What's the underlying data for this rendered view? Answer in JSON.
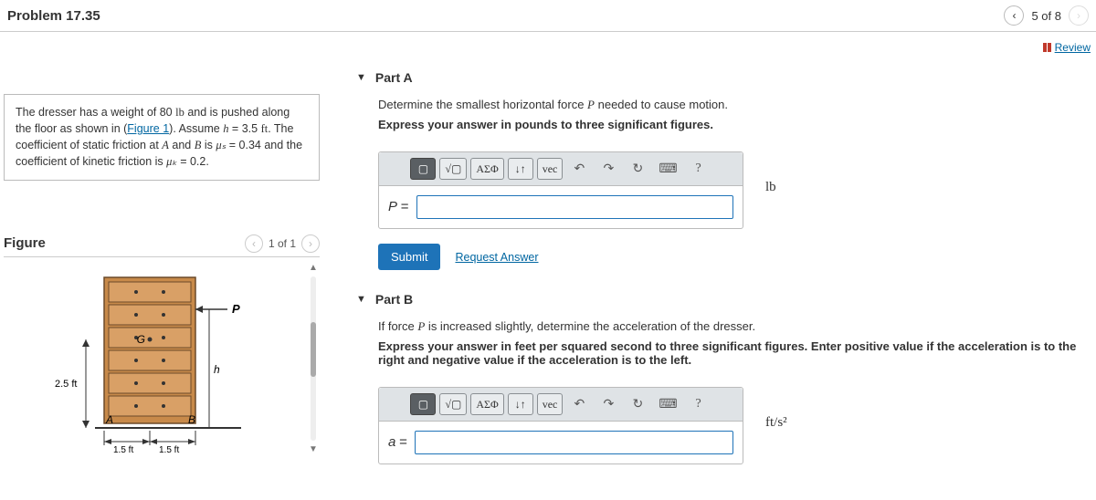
{
  "header": {
    "title": "Problem 17.35",
    "counter": "5 of 8"
  },
  "review_label": "Review",
  "problem": {
    "t1": "The dresser has a weight of 80 ",
    "lb": "lb",
    "t2": " and is pushed along the floor as shown in (",
    "fig_link": "Figure 1",
    "t3": "). Assume ",
    "h_var": "h",
    "t4": " = 3.5 ",
    "ft": "ft",
    "t5": ". The coefficient of static friction at ",
    "A": "A",
    "and": " and ",
    "B": "B",
    "t6": " is ",
    "mu_s": "μₛ",
    "t7": " = 0.34 and the coefficient of kinetic friction is ",
    "mu_k": "μₖ",
    "t8": " = 0.2."
  },
  "figure": {
    "title": "Figure",
    "counter": "1 of 1",
    "labels": {
      "P": "P",
      "G": "G",
      "h": "h",
      "A": "A",
      "B": "B",
      "h25": "2.5 ft",
      "w1": "1.5 ft",
      "w2": "1.5 ft"
    }
  },
  "toolbar": {
    "tpl": "▢",
    "sqrt": "√▢",
    "greek": "ΑΣΦ",
    "updown": "↓↑",
    "vec": "vec",
    "undo": "↶",
    "redo": "↷",
    "reset": "↻",
    "keyb": "⌨",
    "help": "?"
  },
  "partA": {
    "title": "Part A",
    "q": "Determine the smallest horizontal force ",
    "P": "P",
    "q2": " needed to cause motion.",
    "instr": "Express your answer in pounds to three significant figures.",
    "var": "P",
    "eq": "=",
    "unit": "lb",
    "submit": "Submit",
    "request": "Request Answer"
  },
  "partB": {
    "title": "Part B",
    "q": "If force ",
    "P": "P",
    "q2": " is increased slightly, determine the acceleration of the dresser.",
    "instr": "Express your answer in feet per squared second to three significant figures. Enter positive value if the acceleration is to the right and negative value if the acceleration is to the left.",
    "var": "a",
    "eq": "=",
    "unit": "ft/s²"
  }
}
